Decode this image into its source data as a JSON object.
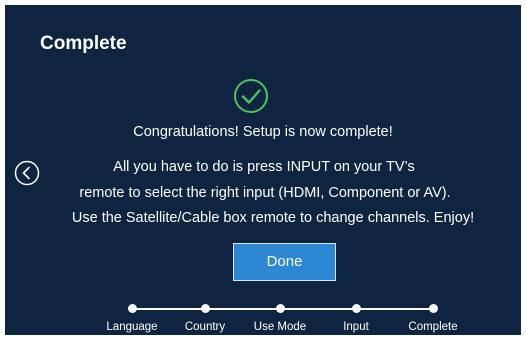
{
  "screen": {
    "title": "Complete",
    "messages": [
      "Congratulations! Setup is now complete!",
      "All you have to do is press INPUT on your TV’s",
      "remote to select the right input (HDMI, Component or AV).",
      "Use the Satellite/Cable box remote to change channels. Enjoy!"
    ],
    "done_label": "Done",
    "icons": {
      "success": "check-circle-icon",
      "back": "chevron-left-circle-icon"
    }
  },
  "steps": [
    {
      "label": "Language",
      "completed": true
    },
    {
      "label": "Country",
      "completed": true
    },
    {
      "label": "Use Mode",
      "completed": true
    },
    {
      "label": "Input",
      "completed": true
    },
    {
      "label": "Complete",
      "completed": true
    }
  ],
  "colors": {
    "background": "#0e2440",
    "accent_green": "#4cc25a",
    "button": "#2d87d2",
    "text": "#ffffff"
  }
}
